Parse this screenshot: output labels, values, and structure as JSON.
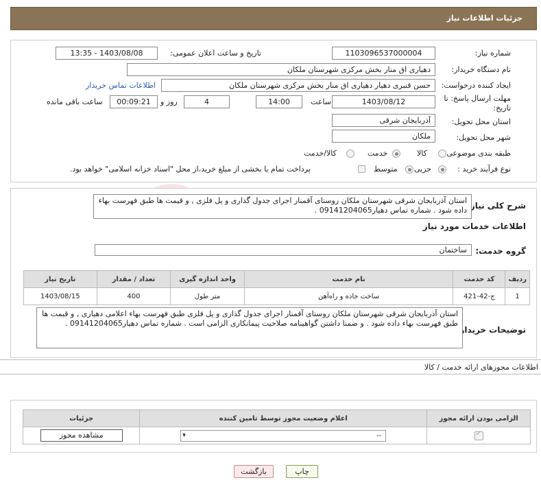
{
  "header": {
    "title": "جزئیات اطلاعات نیاز"
  },
  "form": {
    "need_number_label": "شماره نیاز:",
    "need_number": "1103096537000004",
    "announce_label": "تاریخ و ساعت اعلان عمومی:",
    "announce_value": "1403/08/08 - 13:35",
    "buyer_org_label": "نام دستگاه خریدار:",
    "buyer_org": "دهیاری اق منار بخش مرکزی شهرستان ملکان",
    "creator_label": "ایجاد کننده درخواست:",
    "creator": "حسن قنبری دهیار دهیاری اق منار بخش مرکزی شهرستان ملکان",
    "contact_link": "اطلاعات تماس خریدار",
    "deadline_label_1": "مهلت ارسال پاسخ: تا",
    "deadline_label_2": "تاریخ:",
    "deadline_date": "1403/08/12",
    "time_label": "ساعت",
    "deadline_time": "14:00",
    "days": "4",
    "days_label": "روز و",
    "remaining_time": "00:09:21",
    "remaining_label": "ساعت باقی مانده",
    "province_label": "استان محل تحویل:",
    "province": "آذربایجان شرقی",
    "city_label": "شهر محل تحویل:",
    "city": "ملکان",
    "category_label": "طبقه بندی موضوعی:",
    "category_options": [
      "کالا",
      "خدمت",
      "کالا/خدمت"
    ],
    "category_selected": "خدمت",
    "process_label": "نوع فرآیند خرید :",
    "process_options": [
      "جزیی",
      "متوسط"
    ],
    "process_selected": "جزیی",
    "payment_note": "پرداخت تمام یا بخشی از مبلغ خرید،از محل \"اسناد خزانه اسلامی\" خواهد بود."
  },
  "summary": {
    "label": "شرح کلی نیاز:",
    "text": "استان آذربایجان شرقی شهرستان ملکان روستای آقمنار اجرای جدول گذاری و پل فلزی , و قیمت ها طبق فهرست بهاء داده شود . شماره تماس دهیار09141204065 ."
  },
  "services": {
    "section_title": "اطلاعات خدمات مورد نیاز",
    "group_label": "گروه خدمت:",
    "group_value": "ساختمان",
    "columns": [
      "ردیف",
      "کد خدمت",
      "نام خدمت",
      "واحد اندازه گیری",
      "تعداد / مقدار",
      "تاریخ نیاز"
    ],
    "rows": [
      {
        "idx": "1",
        "code": "ج-42-421",
        "name": "ساخت جاده و راه‌آهن",
        "unit": "متر طول",
        "qty": "400",
        "date": "1403/08/15"
      }
    ]
  },
  "buyer_notes": {
    "label": "توضیحات خریدار:",
    "text": "استان آذربایجان شرقی شهرستان ملکان روستای آقمنار اجرای جدول گذاری و پل فلزی طبق فهرست بهاء اعلامی دهیاری , و قیمت ها طبق فهرست بهاء داده شود . و ضمنا داشتن گواهینامه صلاحیت پیمانکاری الزامی است . شماره تماس دهیار09141204065 ."
  },
  "permits": {
    "section_title": "اطلاعات مجوزهای ارائه خدمت / کالا",
    "columns": [
      "الزامی بودن ارائه مجوز",
      "اعلام وضعیت مجوز توسط تامین کننده",
      "جزئیات"
    ],
    "select_value": "--",
    "view_button": "مشاهده مجوز"
  },
  "footer": {
    "print": "چاپ",
    "back": "بازگشت"
  },
  "watermark": "AriaTender.net"
}
